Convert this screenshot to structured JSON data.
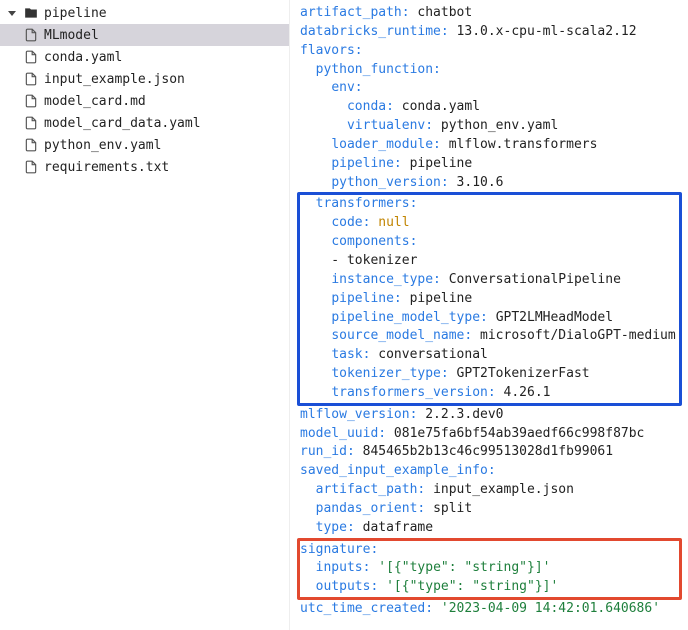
{
  "sidebar": {
    "root": {
      "label": "pipeline"
    },
    "files": [
      {
        "label": "MLmodel",
        "selected": true
      },
      {
        "label": "conda.yaml",
        "selected": false
      },
      {
        "label": "input_example.json",
        "selected": false
      },
      {
        "label": "model_card.md",
        "selected": false
      },
      {
        "label": "model_card_data.yaml",
        "selected": false
      },
      {
        "label": "python_env.yaml",
        "selected": false
      },
      {
        "label": "requirements.txt",
        "selected": false
      }
    ]
  },
  "yaml": {
    "artifact_path_key": "artifact_path:",
    "artifact_path_val": "chatbot",
    "databricks_runtime_key": "databricks_runtime:",
    "databricks_runtime_val": "13.0.x-cpu-ml-scala2.12",
    "flavors_key": "flavors:",
    "python_function_key": "python_function:",
    "env_key": "env:",
    "conda_key": "conda:",
    "conda_val": "conda.yaml",
    "virtualenv_key": "virtualenv:",
    "virtualenv_val": "python_env.yaml",
    "loader_module_key": "loader_module:",
    "loader_module_val": "mlflow.transformers",
    "pipeline_key": "pipeline:",
    "pipeline_val": "pipeline",
    "python_version_key": "python_version:",
    "python_version_val": "3.10.6",
    "transformers_key": "transformers:",
    "code_key": "code:",
    "code_val": "null",
    "components_key": "components:",
    "components_item": "tokenizer",
    "instance_type_key": "instance_type:",
    "instance_type_val": "ConversationalPipeline",
    "t_pipeline_key": "pipeline:",
    "t_pipeline_val": "pipeline",
    "pipeline_model_type_key": "pipeline_model_type:",
    "pipeline_model_type_val": "GPT2LMHeadModel",
    "source_model_name_key": "source_model_name:",
    "source_model_name_val": "microsoft/DialoGPT-medium",
    "task_key": "task:",
    "task_val": "conversational",
    "tokenizer_type_key": "tokenizer_type:",
    "tokenizer_type_val": "GPT2TokenizerFast",
    "transformers_version_key": "transformers_version:",
    "transformers_version_val": "4.26.1",
    "mlflow_version_key": "mlflow_version:",
    "mlflow_version_val": "2.2.3.dev0",
    "model_uuid_key": "model_uuid:",
    "model_uuid_val": "081e75fa6bf54ab39aedf66c998f87bc",
    "run_id_key": "run_id:",
    "run_id_val": "845465b2b13c46c99513028d1fb99061",
    "saved_input_example_info_key": "saved_input_example_info:",
    "sai_artifact_path_key": "artifact_path:",
    "sai_artifact_path_val": "input_example.json",
    "pandas_orient_key": "pandas_orient:",
    "pandas_orient_val": "split",
    "type_key": "type:",
    "type_val": "dataframe",
    "signature_key": "signature:",
    "inputs_key": "inputs:",
    "inputs_val": "'[{\"type\": \"string\"}]'",
    "outputs_key": "outputs:",
    "outputs_val": "'[{\"type\": \"string\"}]'",
    "utc_time_created_key": "utc_time_created:",
    "utc_time_created_val": "'2023-04-09 14:42:01.640686'"
  },
  "highlight": {
    "blue_section": "transformers",
    "red_section": "signature"
  }
}
